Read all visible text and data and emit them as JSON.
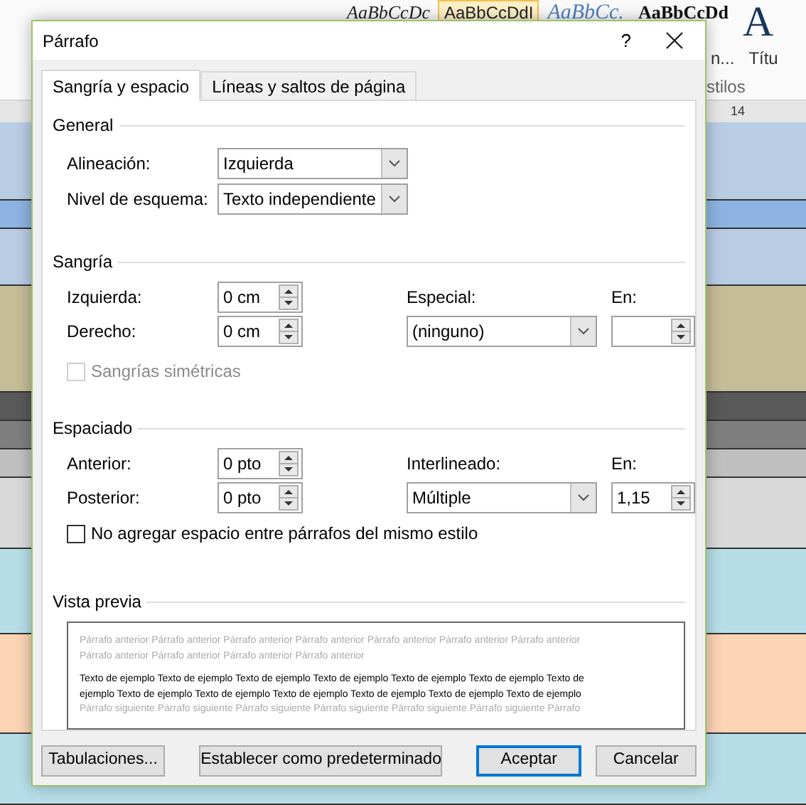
{
  "background": {
    "styles": [
      {
        "text": "AaBbCcDc",
        "kind": "serif-italic",
        "selected": false
      },
      {
        "text": "AaBbCcDdI",
        "kind": "sans",
        "selected": true
      },
      {
        "text": "AaBbCc.",
        "kind": "blue-italic",
        "selected": false
      },
      {
        "text": "AaBbCcDd",
        "kind": "serif-bold",
        "selected": false
      },
      {
        "text": "A",
        "kind": "title",
        "selected": false
      }
    ],
    "style_labels": [
      "n...",
      "Títu"
    ],
    "group_label": "stilos",
    "ruler_number": "14"
  },
  "window": {
    "title": "Párrafo",
    "help": "?"
  },
  "tabs": [
    {
      "label": "Sangría y espacio",
      "selected": true
    },
    {
      "label": "Líneas y saltos de página",
      "selected": false
    }
  ],
  "general": {
    "heading": "General",
    "alignment": {
      "label": "Alineación:",
      "value": "Izquierda"
    },
    "outline_level": {
      "label": "Nivel de esquema:",
      "value": "Texto independiente"
    }
  },
  "indent": {
    "heading": "Sangría",
    "left": {
      "label": "Izquierda:",
      "value": "0 cm"
    },
    "right": {
      "label": "Derecho:",
      "value": "0 cm"
    },
    "special": {
      "label": "Especial:",
      "value": "(ninguno)"
    },
    "by": {
      "label": "En:"
    },
    "mirror": {
      "label": "Sangrías simétricas",
      "checked": false,
      "disabled": true
    }
  },
  "spacing": {
    "heading": "Espaciado",
    "before": {
      "label": "Anterior:",
      "value": "0 pto"
    },
    "after": {
      "label": "Posterior:",
      "value": "0 pto"
    },
    "line": {
      "label": "Interlineado:",
      "value": "Múltiple"
    },
    "at": {
      "label": "En:",
      "value": "1,15"
    },
    "no_space": {
      "label": "No agregar espacio entre párrafos del mismo estilo",
      "checked": false,
      "disabled": false
    }
  },
  "preview": {
    "heading": "Vista previa",
    "previous": "Párrafo anterior Párrafo anterior Párrafo anterior Párrafo anterior Párrafo anterior Párrafo anterior Párrafo anterior Párrafo anterior Párrafo anterior Párrafo anterior Párrafo anterior",
    "sample": "Texto de ejemplo Texto de ejemplo Texto de ejemplo Texto de ejemplo Texto de ejemplo Texto de ejemplo Texto de ejemplo Texto de ejemplo Texto de ejemplo Texto de ejemplo Texto de ejemplo Texto de ejemplo Texto de ejemplo",
    "next": "Párrafo siguiente Párrafo siguiente Párrafo siguiente Párrafo siguiente Párrafo siguiente Párrafo siguiente Párrafo"
  },
  "buttons": [
    {
      "label": "Tabulaciones...",
      "default": false
    },
    {
      "label": "Establecer como predeterminado",
      "default": false
    },
    {
      "label": "Aceptar",
      "default": true
    },
    {
      "label": "Cancelar",
      "default": false
    }
  ]
}
